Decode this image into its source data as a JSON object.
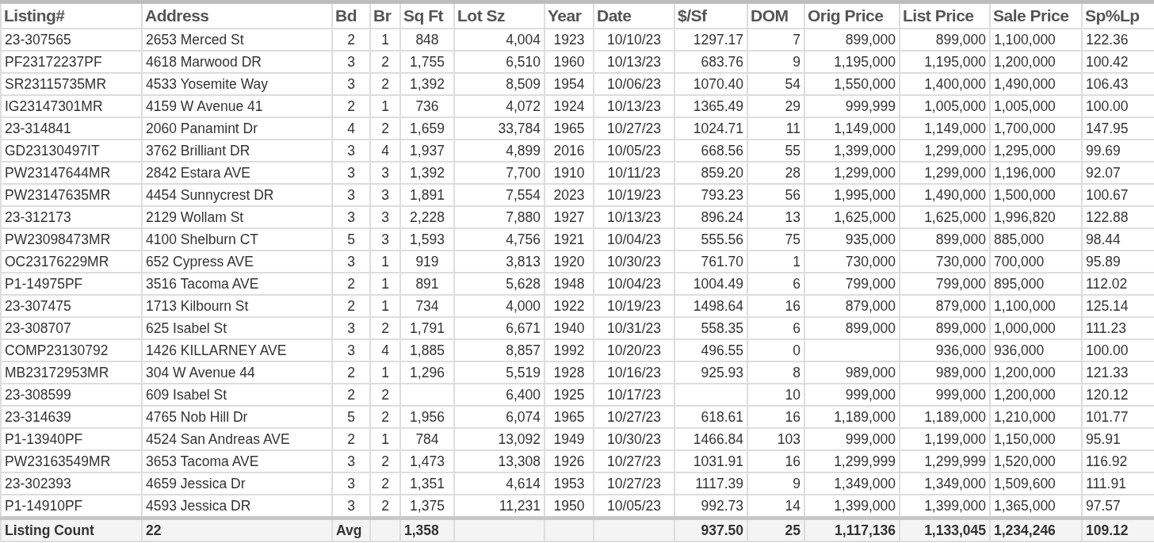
{
  "table": {
    "columns": [
      "Listing#",
      "Address",
      "Bd",
      "Br",
      "Sq Ft",
      "Lot Sz",
      "Year",
      "Date",
      "$/Sf",
      "DOM",
      "Orig Price",
      "List Price",
      "Sale Price",
      "Sp%Lp"
    ],
    "rows": [
      {
        "listing": "23-307565",
        "address": "2653 Merced St",
        "bd": "2",
        "br": "1",
        "sqft": "848",
        "lot": "4,004",
        "year": "1923",
        "date": "10/10/23",
        "ppsf": "1297.17",
        "dom": "7",
        "orig": "899,000",
        "list": "899,000",
        "sale": "1,100,000",
        "splp": "122.36"
      },
      {
        "listing": "PF23172237PF",
        "address": "4618 Marwood DR",
        "bd": "3",
        "br": "2",
        "sqft": "1,755",
        "lot": "6,510",
        "year": "1960",
        "date": "10/13/23",
        "ppsf": "683.76",
        "dom": "9",
        "orig": "1,195,000",
        "list": "1,195,000",
        "sale": "1,200,000",
        "splp": "100.42"
      },
      {
        "listing": "SR23115735MR",
        "address": "4533 Yosemite Way",
        "bd": "3",
        "br": "2",
        "sqft": "1,392",
        "lot": "8,509",
        "year": "1954",
        "date": "10/06/23",
        "ppsf": "1070.40",
        "dom": "54",
        "orig": "1,550,000",
        "list": "1,400,000",
        "sale": "1,490,000",
        "splp": "106.43"
      },
      {
        "listing": "IG23147301MR",
        "address": "4159 W Avenue 41",
        "bd": "2",
        "br": "1",
        "sqft": "736",
        "lot": "4,072",
        "year": "1924",
        "date": "10/13/23",
        "ppsf": "1365.49",
        "dom": "29",
        "orig": "999,999",
        "list": "1,005,000",
        "sale": "1,005,000",
        "splp": "100.00"
      },
      {
        "listing": "23-314841",
        "address": "2060 Panamint Dr",
        "bd": "4",
        "br": "2",
        "sqft": "1,659",
        "lot": "33,784",
        "year": "1965",
        "date": "10/27/23",
        "ppsf": "1024.71",
        "dom": "11",
        "orig": "1,149,000",
        "list": "1,149,000",
        "sale": "1,700,000",
        "splp": "147.95"
      },
      {
        "listing": "GD23130497IT",
        "address": "3762 Brilliant DR",
        "bd": "3",
        "br": "4",
        "sqft": "1,937",
        "lot": "4,899",
        "year": "2016",
        "date": "10/05/23",
        "ppsf": "668.56",
        "dom": "55",
        "orig": "1,399,000",
        "list": "1,299,000",
        "sale": "1,295,000",
        "splp": "99.69"
      },
      {
        "listing": "PW23147644MR",
        "address": "2842 Estara AVE",
        "bd": "3",
        "br": "3",
        "sqft": "1,392",
        "lot": "7,700",
        "year": "1910",
        "date": "10/11/23",
        "ppsf": "859.20",
        "dom": "28",
        "orig": "1,299,000",
        "list": "1,299,000",
        "sale": "1,196,000",
        "splp": "92.07"
      },
      {
        "listing": "PW23147635MR",
        "address": "4454 Sunnycrest DR",
        "bd": "3",
        "br": "3",
        "sqft": "1,891",
        "lot": "7,554",
        "year": "2023",
        "date": "10/19/23",
        "ppsf": "793.23",
        "dom": "56",
        "orig": "1,995,000",
        "list": "1,490,000",
        "sale": "1,500,000",
        "splp": "100.67"
      },
      {
        "listing": "23-312173",
        "address": "2129 Wollam St",
        "bd": "3",
        "br": "3",
        "sqft": "2,228",
        "lot": "7,880",
        "year": "1927",
        "date": "10/13/23",
        "ppsf": "896.24",
        "dom": "13",
        "orig": "1,625,000",
        "list": "1,625,000",
        "sale": "1,996,820",
        "splp": "122.88"
      },
      {
        "listing": "PW23098473MR",
        "address": "4100 Shelburn CT",
        "bd": "5",
        "br": "3",
        "sqft": "1,593",
        "lot": "4,756",
        "year": "1921",
        "date": "10/04/23",
        "ppsf": "555.56",
        "dom": "75",
        "orig": "935,000",
        "list": "899,000",
        "sale": "885,000",
        "splp": "98.44"
      },
      {
        "listing": "OC23176229MR",
        "address": "652 Cypress AVE",
        "bd": "3",
        "br": "1",
        "sqft": "919",
        "lot": "3,813",
        "year": "1920",
        "date": "10/30/23",
        "ppsf": "761.70",
        "dom": "1",
        "orig": "730,000",
        "list": "730,000",
        "sale": "700,000",
        "splp": "95.89"
      },
      {
        "listing": "P1-14975PF",
        "address": "3516 Tacoma AVE",
        "bd": "2",
        "br": "1",
        "sqft": "891",
        "lot": "5,628",
        "year": "1948",
        "date": "10/04/23",
        "ppsf": "1004.49",
        "dom": "6",
        "orig": "799,000",
        "list": "799,000",
        "sale": "895,000",
        "splp": "112.02"
      },
      {
        "listing": "23-307475",
        "address": "1713 Kilbourn St",
        "bd": "2",
        "br": "1",
        "sqft": "734",
        "lot": "4,000",
        "year": "1922",
        "date": "10/19/23",
        "ppsf": "1498.64",
        "dom": "16",
        "orig": "879,000",
        "list": "879,000",
        "sale": "1,100,000",
        "splp": "125.14"
      },
      {
        "listing": "23-308707",
        "address": "625 Isabel St",
        "bd": "3",
        "br": "2",
        "sqft": "1,791",
        "lot": "6,671",
        "year": "1940",
        "date": "10/31/23",
        "ppsf": "558.35",
        "dom": "6",
        "orig": "899,000",
        "list": "899,000",
        "sale": "1,000,000",
        "splp": "111.23"
      },
      {
        "listing": "COMP23130792",
        "address": "1426 KILLARNEY AVE",
        "bd": "3",
        "br": "4",
        "sqft": "1,885",
        "lot": "8,857",
        "year": "1992",
        "date": "10/20/23",
        "ppsf": "496.55",
        "dom": "0",
        "list": "936,000",
        "sale": "936,000",
        "splp": "100.00"
      },
      {
        "listing": "MB23172953MR",
        "address": "304 W Avenue 44",
        "bd": "2",
        "br": "1",
        "sqft": "1,296",
        "lot": "5,519",
        "year": "1928",
        "date": "10/16/23",
        "ppsf": "925.93",
        "dom": "8",
        "orig": "989,000",
        "list": "989,000",
        "sale": "1,200,000",
        "splp": "121.33"
      },
      {
        "listing": "23-308599",
        "address": "609 Isabel St",
        "bd": "2",
        "br": "2",
        "lot": "6,400",
        "year": "1925",
        "date": "10/17/23",
        "dom": "10",
        "orig": "999,000",
        "list": "999,000",
        "sale": "1,200,000",
        "splp": "120.12"
      },
      {
        "listing": "23-314639",
        "address": "4765 Nob Hill Dr",
        "bd": "5",
        "br": "2",
        "sqft": "1,956",
        "lot": "6,074",
        "year": "1965",
        "date": "10/27/23",
        "ppsf": "618.61",
        "dom": "16",
        "orig": "1,189,000",
        "list": "1,189,000",
        "sale": "1,210,000",
        "splp": "101.77"
      },
      {
        "listing": "P1-13940PF",
        "address": "4524 San Andreas AVE",
        "bd": "2",
        "br": "1",
        "sqft": "784",
        "lot": "13,092",
        "year": "1949",
        "date": "10/30/23",
        "ppsf": "1466.84",
        "dom": "103",
        "orig": "999,000",
        "list": "1,199,000",
        "sale": "1,150,000",
        "splp": "95.91"
      },
      {
        "listing": "PW23163549MR",
        "address": "3653 Tacoma AVE",
        "bd": "3",
        "br": "2",
        "sqft": "1,473",
        "lot": "13,308",
        "year": "1926",
        "date": "10/27/23",
        "ppsf": "1031.91",
        "dom": "16",
        "orig": "1,299,999",
        "list": "1,299,999",
        "sale": "1,520,000",
        "splp": "116.92"
      },
      {
        "listing": "23-302393",
        "address": "4659 Jessica Dr",
        "bd": "3",
        "br": "2",
        "sqft": "1,351",
        "lot": "4,614",
        "year": "1953",
        "date": "10/27/23",
        "ppsf": "1117.39",
        "dom": "9",
        "orig": "1,349,000",
        "list": "1,349,000",
        "sale": "1,509,600",
        "splp": "111.91"
      },
      {
        "listing": "P1-14910PF",
        "address": "4593 Jessica DR",
        "bd": "3",
        "br": "2",
        "sqft": "1,375",
        "lot": "11,231",
        "year": "1950",
        "date": "10/05/23",
        "ppsf": "992.73",
        "dom": "14",
        "orig": "1,399,000",
        "list": "1,399,000",
        "sale": "1,365,000",
        "splp": "97.57"
      }
    ],
    "footer": {
      "listing": "Listing Count",
      "address": "22",
      "bd": "Avg",
      "sqft": "1,358",
      "ppsf": "937.50",
      "dom": "25",
      "orig": "1,117,136",
      "list": "1,133,045",
      "sale": "1,234,246",
      "splp": "109.12"
    }
  }
}
